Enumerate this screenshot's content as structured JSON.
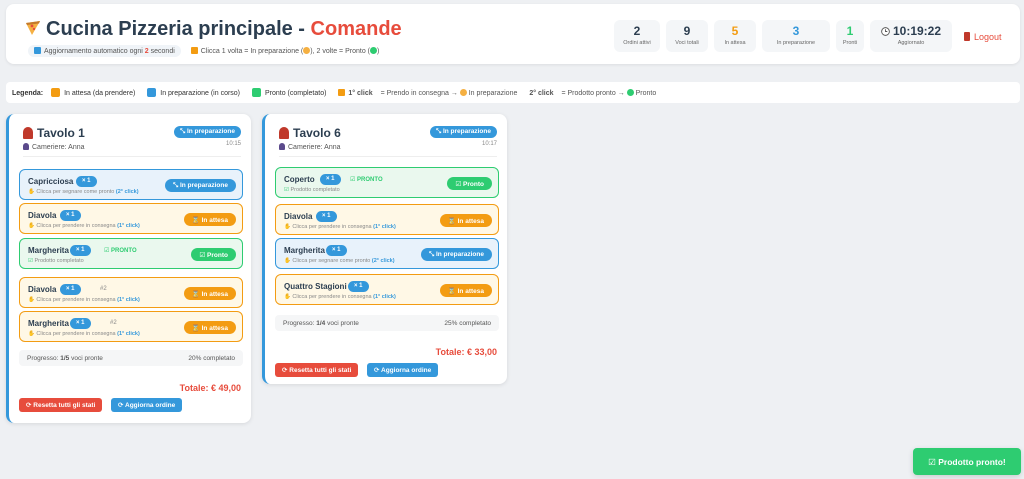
{
  "header": {
    "title_main": "Cucina Pizzeria principale - ",
    "title_accent": "Comande",
    "auto_refresh_prefix": "Aggiornamento automatico ogni ",
    "auto_refresh_value": "2",
    "auto_refresh_suffix": " secondi",
    "click_hint_a": "Clicca 1 volta = In preparazione (",
    "click_hint_b": "), 2 volte = Pronto (",
    "click_hint_c": ")",
    "stats": [
      {
        "value": "2",
        "label": "Ordini attivi",
        "color": "#2c3e50"
      },
      {
        "value": "9",
        "label": "Voci totali",
        "color": "#2c3e50"
      },
      {
        "value": "5",
        "label": "In attesa",
        "color": "#f39c12"
      },
      {
        "value": "3",
        "label": "In preparazione",
        "color": "#3498db"
      },
      {
        "value": "1",
        "label": "Pronti",
        "color": "#2ecc71"
      }
    ],
    "clock": {
      "time": "10:19:22",
      "label": "Aggiornato"
    },
    "logout": "Logout"
  },
  "legend": {
    "title": "Legenda:",
    "waiting": "In attesa (da prendere)",
    "preparing": "In preparazione (in corso)",
    "ready": "Pronto (completato)",
    "first_click_label": "1° click",
    "first_click_text": " = Prendo in consegna → ",
    "first_click_state": " In preparazione",
    "second_click_label": "2° click",
    "second_click_text": " = Prodotto pronto → ",
    "second_click_state": " Pronto"
  },
  "colors": {
    "waiting": "#f39c12",
    "preparing": "#3498db",
    "ready": "#2ecc71",
    "accent": "#e74c3c"
  },
  "tables": [
    {
      "title": "Tavolo 1",
      "waiter": "Cameriere: Anna",
      "time": "10:15",
      "status": "In preparazione",
      "items": [
        {
          "name": "Capricciosa",
          "qty": "× 1",
          "idx": "",
          "state": "prep",
          "tag": "",
          "hint_pre": "Clicca per segnare come pronto ",
          "hint_bold": "(2° click)",
          "action": "In preparazione"
        },
        {
          "name": "Diavola",
          "qty": "× 1",
          "idx": "",
          "state": "wait",
          "tag": "",
          "hint_pre": "Clicca per prendere in consegna ",
          "hint_bold": "(1° click)",
          "action": "In attesa"
        },
        {
          "name": "Margherita",
          "qty": "× 1",
          "idx": "",
          "state": "done",
          "tag": "PRONTO",
          "hint_pre": "Prodotto completato",
          "hint_bold": "",
          "action": "Pronto"
        },
        {
          "name": "Diavola",
          "qty": "× 1",
          "idx": "#2",
          "state": "wait",
          "tag": "",
          "hint_pre": "Clicca per prendere in consegna ",
          "hint_bold": "(1° click)",
          "action": "In attesa"
        },
        {
          "name": "Margherita",
          "qty": "× 1",
          "idx": "#2",
          "state": "wait",
          "tag": "",
          "hint_pre": "Clicca per prendere in consegna ",
          "hint_bold": "(1° click)",
          "action": "In attesa"
        }
      ],
      "progress_pre": "Progresso: ",
      "progress_val": "1/5",
      "progress_post": " voci pronte",
      "progress_pct": "20% completato",
      "total": "Totale: € 49,00",
      "reset": "Resetta tutti gli stati",
      "refresh": "Aggiorna ordine"
    },
    {
      "title": "Tavolo 6",
      "waiter": "Cameriere: Anna",
      "time": "10:17",
      "status": "In preparazione",
      "items": [
        {
          "name": "Coperto",
          "qty": "× 1",
          "idx": "",
          "state": "done",
          "tag": "PRONTO",
          "hint_pre": "Prodotto completato",
          "hint_bold": "",
          "action": "Pronto"
        },
        {
          "name": "Diavola",
          "qty": "× 1",
          "idx": "",
          "state": "wait",
          "tag": "",
          "hint_pre": "Clicca per prendere in consegna ",
          "hint_bold": "(1° click)",
          "action": "In attesa"
        },
        {
          "name": "Margherita",
          "qty": "× 1",
          "idx": "",
          "state": "prep",
          "tag": "",
          "hint_pre": "Clicca per segnare come pronto ",
          "hint_bold": "(2° click)",
          "action": "In preparazione"
        },
        {
          "name": "Quattro Stagioni",
          "qty": "× 1",
          "idx": "",
          "state": "wait",
          "tag": "",
          "hint_pre": "Clicca per prendere in consegna ",
          "hint_bold": "(1° click)",
          "action": "In attesa"
        }
      ],
      "progress_pre": "Progresso: ",
      "progress_val": "1/4",
      "progress_post": " voci pronte",
      "progress_pct": "25% completato",
      "total": "Totale: € 33,00",
      "reset": "Resetta tutti gli stati",
      "refresh": "Aggiorna ordine"
    }
  ],
  "toast": "Prodotto pronto!"
}
